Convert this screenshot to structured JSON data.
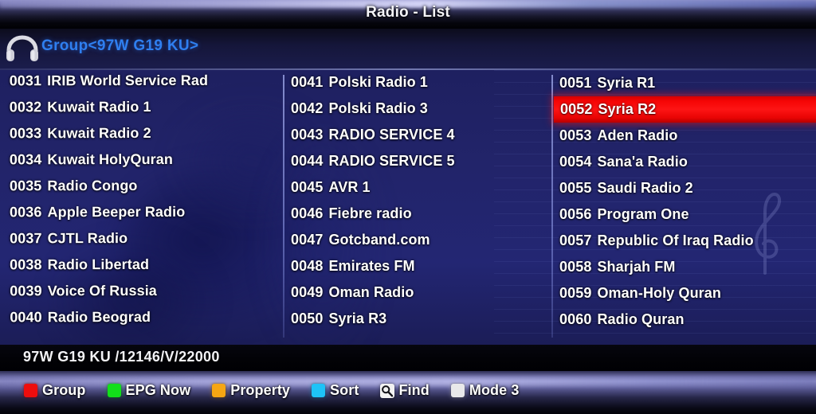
{
  "header": {
    "title": "Radio - List"
  },
  "group": {
    "icon": "headphones-icon",
    "label": "Group<97W G19 KU>"
  },
  "list": {
    "columns": [
      {
        "id": "column-1",
        "rows": [
          {
            "number": "0031",
            "name": "IRIB World Service Rad",
            "selected": false
          },
          {
            "number": "0032",
            "name": "Kuwait Radio 1",
            "selected": false
          },
          {
            "number": "0033",
            "name": "Kuwait Radio 2",
            "selected": false
          },
          {
            "number": "0034",
            "name": "Kuwait HolyQuran",
            "selected": false
          },
          {
            "number": "0035",
            "name": "Radio Congo",
            "selected": false
          },
          {
            "number": "0036",
            "name": "Apple Beeper Radio",
            "selected": false
          },
          {
            "number": "0037",
            "name": "CJTL Radio",
            "selected": false
          },
          {
            "number": "0038",
            "name": "Radio Libertad",
            "selected": false
          },
          {
            "number": "0039",
            "name": "Voice Of Russia",
            "selected": false
          },
          {
            "number": "0040",
            "name": "Radio Beograd",
            "selected": false
          }
        ]
      },
      {
        "id": "column-2",
        "rows": [
          {
            "number": "0041",
            "name": "Polski Radio 1",
            "selected": false
          },
          {
            "number": "0042",
            "name": "Polski Radio 3",
            "selected": false
          },
          {
            "number": "0043",
            "name": "RADIO SERVICE 4",
            "selected": false
          },
          {
            "number": "0044",
            "name": "RADIO SERVICE 5",
            "selected": false
          },
          {
            "number": "0045",
            "name": "AVR 1",
            "selected": false
          },
          {
            "number": "0046",
            "name": "Fiebre radio",
            "selected": false
          },
          {
            "number": "0047",
            "name": "Gotcband.com",
            "selected": false
          },
          {
            "number": "0048",
            "name": "Emirates FM",
            "selected": false
          },
          {
            "number": "0049",
            "name": "Oman Radio",
            "selected": false
          },
          {
            "number": "0050",
            "name": "Syria R3",
            "selected": false
          }
        ]
      },
      {
        "id": "column-3",
        "rows": [
          {
            "number": "0051",
            "name": "Syria R1",
            "selected": false
          },
          {
            "number": "0052",
            "name": "Syria R2",
            "selected": true
          },
          {
            "number": "0053",
            "name": "Aden Radio",
            "selected": false
          },
          {
            "number": "0054",
            "name": "Sana'a Radio",
            "selected": false
          },
          {
            "number": "0055",
            "name": "Saudi Radio 2",
            "selected": false
          },
          {
            "number": "0056",
            "name": "Program One",
            "selected": false
          },
          {
            "number": "0057",
            "name": "Republic Of Iraq Radio",
            "selected": false
          },
          {
            "number": "0058",
            "name": "Sharjah FM",
            "selected": false
          },
          {
            "number": "0059",
            "name": "Oman-Holy Quran",
            "selected": false
          },
          {
            "number": "0060",
            "name": "Radio Quran",
            "selected": false
          }
        ]
      }
    ]
  },
  "status": {
    "text": "97W G19 KU /12146/V/22000"
  },
  "footer": {
    "items": [
      {
        "label": "Group",
        "icon": "red-key-icon",
        "color": "#ef0d0d",
        "type": "swatch"
      },
      {
        "label": "EPG Now",
        "icon": "green-key-icon",
        "color": "#12e01a",
        "type": "swatch"
      },
      {
        "label": "Property",
        "icon": "yellow-key-icon",
        "color": "#f6a613",
        "type": "swatch"
      },
      {
        "label": "Sort",
        "icon": "blue-key-icon",
        "color": "#1ec3f7",
        "type": "swatch"
      },
      {
        "label": "Find",
        "icon": "search-icon",
        "color": "#f2f2f2",
        "type": "glyph"
      },
      {
        "label": "Mode 3",
        "icon": "white-key-icon",
        "color": "#e8e8ea",
        "type": "swatch"
      }
    ]
  },
  "colors": {
    "selected_row": "#f60505",
    "group_label": "#2f7ff0",
    "list_background": "#22246a",
    "title_text": "#f4f4f8"
  }
}
